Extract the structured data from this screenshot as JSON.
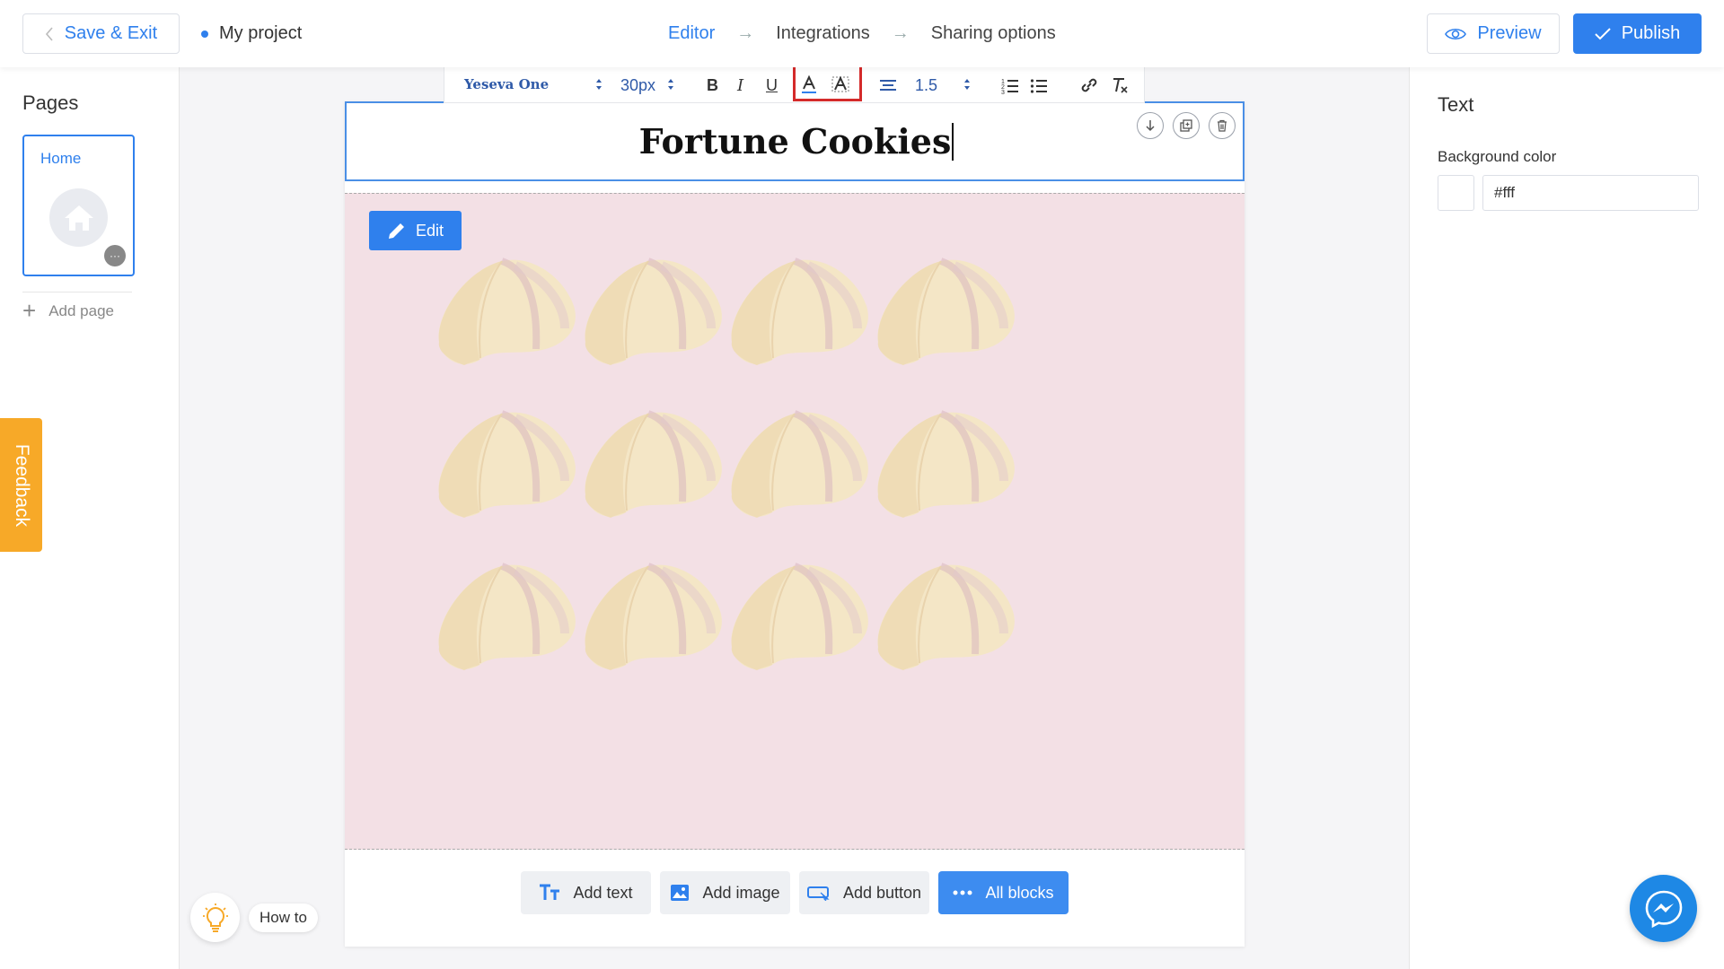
{
  "header": {
    "save_exit_label": "Save & Exit",
    "project_name": "My project",
    "steps": [
      "Editor",
      "Integrations",
      "Sharing options"
    ],
    "active_step": "Editor",
    "preview_label": "Preview",
    "publish_label": "Publish"
  },
  "sidebar": {
    "title": "Pages",
    "pages": [
      {
        "name": "Home",
        "icon": "home-icon"
      }
    ],
    "add_page_label": "Add page"
  },
  "feedback": {
    "label": "Feedback"
  },
  "toolbar": {
    "font_family": "Yeseva One",
    "font_size": "30px",
    "bold": "B",
    "italic": "I",
    "underline": "U",
    "line_height": "1.5",
    "highlighted_group": [
      "text-color",
      "text-background-color"
    ]
  },
  "canvas": {
    "title_text": "Fortune Cookies",
    "edit_label": "Edit",
    "image_description_tile": "fortune-cookie",
    "image_background": "#f3e0e5",
    "add_buttons": [
      {
        "label": "Add text",
        "icon": "text-icon"
      },
      {
        "label": "Add image",
        "icon": "image-icon"
      },
      {
        "label": "Add button",
        "icon": "button-icon"
      },
      {
        "label": "All blocks",
        "icon": "more-icon"
      }
    ]
  },
  "right_panel": {
    "title": "Text",
    "background_label": "Background color",
    "background_value": "#fff"
  },
  "howto": {
    "label": "How to"
  },
  "colors": {
    "accent": "#2f80ed",
    "feedback": "#f7a928",
    "highlight_box": "#d42a2a",
    "messenger": "#1e88e5"
  }
}
